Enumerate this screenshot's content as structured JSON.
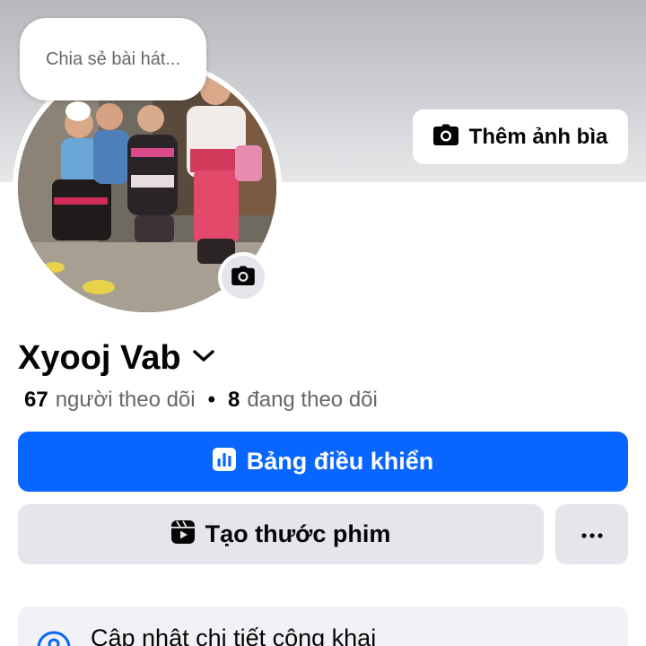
{
  "note": {
    "placeholder": "Chia sẻ bài hát..."
  },
  "cover": {
    "add_cover_label": "Thêm ảnh bìa"
  },
  "profile": {
    "name": "Xyooj Vab",
    "followers_count": "67",
    "followers_label": "người theo dõi",
    "following_count": "8",
    "following_label": "đang theo dõi",
    "separator": "•"
  },
  "actions": {
    "dashboard_label": "Bảng điều khiển",
    "create_reel_label": "Tạo thước phim",
    "more_label": "···"
  },
  "card": {
    "update_details_label": "Cập nhật chi tiết công khai"
  },
  "icons": {
    "cover_camera": "camera-icon",
    "avatar_camera": "camera-icon",
    "name_dropdown": "chevron-down-icon",
    "dashboard": "bar-chart-icon",
    "reel": "clapperboard-icon",
    "more": "ellipsis-icon",
    "card": "details-icon"
  },
  "colors": {
    "primary_button": "#0866ff",
    "secondary_button": "#e4e6eb",
    "text_primary": "#050505",
    "text_secondary": "#65676b"
  }
}
